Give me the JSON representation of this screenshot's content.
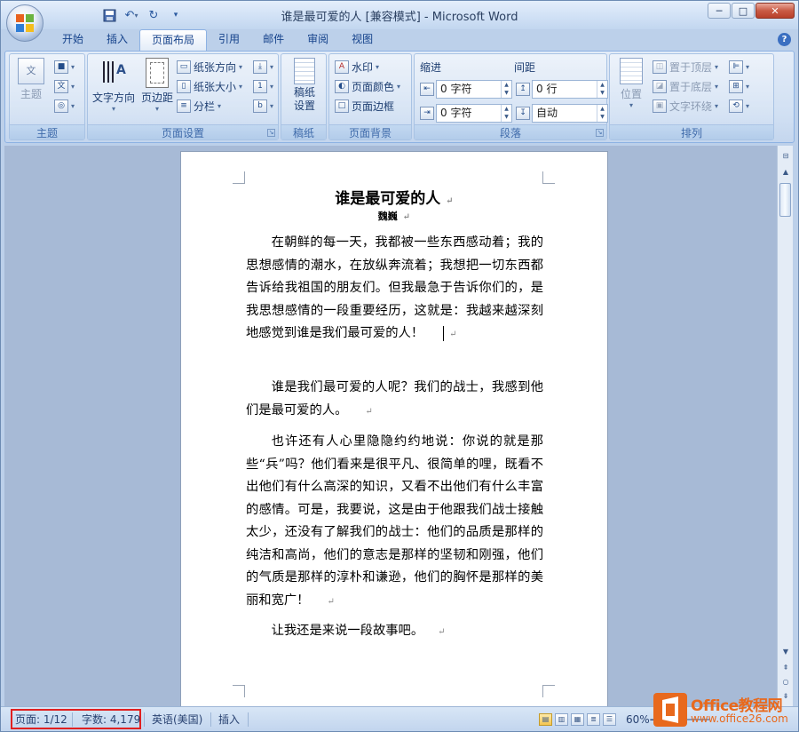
{
  "window": {
    "title": "谁是最可爱的人 [兼容模式] - Microsoft Word",
    "controls": {
      "minimize": "─",
      "maximize": "□",
      "close": "✕"
    }
  },
  "qat": {
    "save_icon": "save-icon",
    "undo_icon": "undo-icon",
    "redo_icon": "redo-icon",
    "customize_icon": "customize-icon"
  },
  "tabs": [
    {
      "label": "开始",
      "active": false
    },
    {
      "label": "插入",
      "active": false
    },
    {
      "label": "页面布局",
      "active": true
    },
    {
      "label": "引用",
      "active": false
    },
    {
      "label": "邮件",
      "active": false
    },
    {
      "label": "审阅",
      "active": false
    },
    {
      "label": "视图",
      "active": false
    }
  ],
  "ribbon": {
    "theme": {
      "label": "主题",
      "button": "主题"
    },
    "page_setup": {
      "label": "页面设置",
      "text_direction": "文字方向",
      "margins": "页边距",
      "orientation": "纸张方向",
      "size": "纸张大小",
      "columns": "分栏"
    },
    "draft": {
      "label": "稿纸",
      "button": "稿纸\n设置"
    },
    "page_background": {
      "label": "页面背景",
      "watermark": "水印",
      "page_color": "页面颜色",
      "page_borders": "页面边框"
    },
    "paragraph": {
      "label": "段落",
      "indent_header": "缩进",
      "spacing_header": "间距",
      "indent_left": "0 字符",
      "indent_right": "0 字符",
      "spacing_before": "0 行",
      "spacing_after": "自动"
    },
    "arrange": {
      "label": "排列",
      "position": "位置",
      "bring_front": "置于顶层",
      "send_back": "置于底层",
      "text_wrap": "文字环绕"
    }
  },
  "document": {
    "title": "谁是最可爱的人",
    "author": "魏巍",
    "paragraphs": [
      "在朝鲜的每一天，我都被一些东西感动着；我的思想感情的潮水，在放纵奔流着；我想把一切东西都告诉给我祖国的朋友们。但我最急于告诉你们的，是我思想感情的一段重要经历，这就是：我越来越深刻地感觉到谁是我们最可爱的人！",
      "谁是我们最可爱的人呢？我们的战士，我感到他们是最可爱的人。",
      "也许还有人心里隐隐约约地说：你说的就是那些“兵”吗？他们看来是很平凡、很简单的哩，既看不出他们有什么高深的知识，又看不出他们有什么丰富的感情。可是，我要说，这是由于他跟我们战士接触太少，还没有了解我们的战士：他们的品质是那样的纯洁和高尚，他们的意志是那样的坚韧和刚强，他们的气质是那样的淳朴和谦逊，他们的胸怀是那样的美丽和宽广！",
      "让我还是来说一段故事吧。"
    ],
    "paragraph_mark": "↵"
  },
  "statusbar": {
    "page": "页面: 1/12",
    "words": "字数: 4,179",
    "language": "英语(美国)",
    "mode": "插入",
    "zoom": "60%"
  },
  "watermark_brand": {
    "name": "Office教程网",
    "url": "www.office26.com"
  }
}
